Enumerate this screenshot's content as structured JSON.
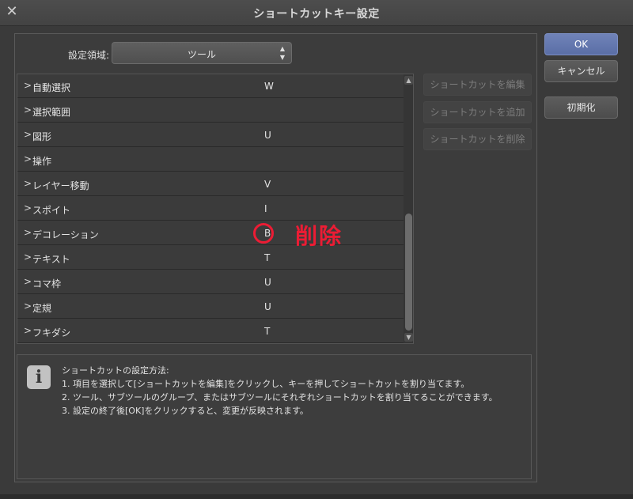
{
  "window": {
    "title": "ショートカットキー設定",
    "close_icon": "close-icon"
  },
  "area": {
    "label": "設定領域:",
    "selected": "ツール"
  },
  "list": {
    "rows": [
      {
        "name": "自動選択",
        "key": "W"
      },
      {
        "name": "選択範囲",
        "key": ""
      },
      {
        "name": "図形",
        "key": "U"
      },
      {
        "name": "操作",
        "key": ""
      },
      {
        "name": "レイヤー移動",
        "key": "V"
      },
      {
        "name": "スポイト",
        "key": "I"
      },
      {
        "name": "デコレーション",
        "key": "B"
      },
      {
        "name": "テキスト",
        "key": "T"
      },
      {
        "name": "コマ枠",
        "key": "U"
      },
      {
        "name": "定規",
        "key": "U"
      },
      {
        "name": "フキダシ",
        "key": "T"
      }
    ]
  },
  "side_buttons": {
    "edit": "ショートカットを編集",
    "add": "ショートカットを追加",
    "delete": "ショートカットを削除"
  },
  "dialog_buttons": {
    "ok": "OK",
    "cancel": "キャンセル",
    "reset": "初期化"
  },
  "info": {
    "icon": "info-icon",
    "title": "ショートカットの設定方法:",
    "line1": "1. 項目を選択して[ショートカットを編集]をクリックし、キーを押してショートカットを割り当てます。",
    "line2": "2. ツール、サブツールのグループ、またはサブツールにそれぞれショートカットを割り当てることができます。",
    "line3": "3. 設定の終了後[OK]をクリックすると、変更が反映されます。"
  },
  "annotation": {
    "text": "削除",
    "color": "#ec1c34"
  },
  "colors": {
    "background": "#3a3a3a",
    "primary_button": "#5a6ea6"
  }
}
